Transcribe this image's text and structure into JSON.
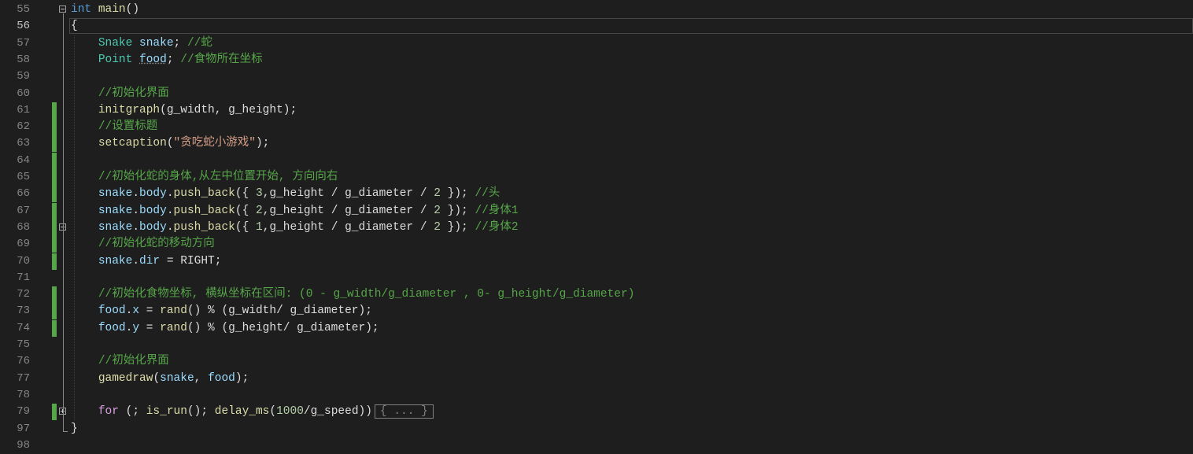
{
  "editor": {
    "lines": [
      {
        "no": "55",
        "fold": "minus",
        "mark": false,
        "tokens": [
          {
            "t": "int",
            "c": "kw"
          },
          {
            "t": " ",
            "c": "pl"
          },
          {
            "t": "main",
            "c": "fn"
          },
          {
            "t": "()",
            "c": "pl"
          }
        ]
      },
      {
        "no": "56",
        "current": true,
        "fold": "",
        "mark": false,
        "tokens": [
          {
            "t": "{",
            "c": "pl"
          }
        ]
      },
      {
        "no": "57",
        "fold": "",
        "mark": false,
        "tokens": [
          {
            "t": "    ",
            "c": "pl"
          },
          {
            "t": "Snake",
            "c": "type"
          },
          {
            "t": " ",
            "c": "pl"
          },
          {
            "t": "snake",
            "c": "var"
          },
          {
            "t": "; ",
            "c": "pl"
          },
          {
            "t": "//蛇",
            "c": "com"
          }
        ]
      },
      {
        "no": "58",
        "fold": "",
        "mark": false,
        "tokens": [
          {
            "t": "    ",
            "c": "pl"
          },
          {
            "t": "Point",
            "c": "type"
          },
          {
            "t": " ",
            "c": "pl"
          },
          {
            "t": "food",
            "c": "var"
          },
          {
            "t": "; ",
            "c": "pl"
          },
          {
            "t": "//食物所在坐标",
            "c": "com"
          }
        ]
      },
      {
        "no": "59",
        "fold": "",
        "mark": false,
        "tokens": []
      },
      {
        "no": "60",
        "fold": "",
        "mark": false,
        "tokens": [
          {
            "t": "    ",
            "c": "pl"
          },
          {
            "t": "//初始化界面",
            "c": "com"
          }
        ]
      },
      {
        "no": "61",
        "fold": "",
        "mark": true,
        "tokens": [
          {
            "t": "    ",
            "c": "pl"
          },
          {
            "t": "initgraph",
            "c": "fn"
          },
          {
            "t": "(g_width, g_height);",
            "c": "pl"
          }
        ]
      },
      {
        "no": "62",
        "fold": "",
        "mark": true,
        "tokens": [
          {
            "t": "    ",
            "c": "pl"
          },
          {
            "t": "//设置标题",
            "c": "com"
          }
        ]
      },
      {
        "no": "63",
        "fold": "",
        "mark": true,
        "tokens": [
          {
            "t": "    ",
            "c": "pl"
          },
          {
            "t": "setcaption",
            "c": "fn"
          },
          {
            "t": "(",
            "c": "pl"
          },
          {
            "t": "\"贪吃蛇小游戏\"",
            "c": "str"
          },
          {
            "t": ");",
            "c": "pl"
          }
        ]
      },
      {
        "no": "64",
        "fold": "",
        "mark": true,
        "tokens": []
      },
      {
        "no": "65",
        "fold": "",
        "mark": true,
        "tokens": [
          {
            "t": "    ",
            "c": "pl"
          },
          {
            "t": "//初始化蛇的身体,从左中位置开始, 方向向右",
            "c": "com"
          }
        ]
      },
      {
        "no": "66",
        "fold": "",
        "mark": true,
        "tokens": [
          {
            "t": "    ",
            "c": "pl"
          },
          {
            "t": "snake",
            "c": "var"
          },
          {
            "t": ".",
            "c": "pl"
          },
          {
            "t": "body",
            "c": "var"
          },
          {
            "t": ".",
            "c": "pl"
          },
          {
            "t": "push_back",
            "c": "fn"
          },
          {
            "t": "({ ",
            "c": "pl"
          },
          {
            "t": "3",
            "c": "num"
          },
          {
            "t": ",g_height / g_diameter / ",
            "c": "pl"
          },
          {
            "t": "2",
            "c": "num"
          },
          {
            "t": " }); ",
            "c": "pl"
          },
          {
            "t": "//头",
            "c": "com"
          }
        ]
      },
      {
        "no": "67",
        "fold": "",
        "mark": true,
        "tokens": [
          {
            "t": "    ",
            "c": "pl"
          },
          {
            "t": "snake",
            "c": "var"
          },
          {
            "t": ".",
            "c": "pl"
          },
          {
            "t": "body",
            "c": "var"
          },
          {
            "t": ".",
            "c": "pl"
          },
          {
            "t": "push_back",
            "c": "fn"
          },
          {
            "t": "({ ",
            "c": "pl"
          },
          {
            "t": "2",
            "c": "num"
          },
          {
            "t": ",g_height / g_diameter / ",
            "c": "pl"
          },
          {
            "t": "2",
            "c": "num"
          },
          {
            "t": " }); ",
            "c": "pl"
          },
          {
            "t": "//身体1",
            "c": "com"
          }
        ]
      },
      {
        "no": "68",
        "fold": "minus",
        "mark": true,
        "tokens": [
          {
            "t": "    ",
            "c": "pl"
          },
          {
            "t": "snake",
            "c": "var"
          },
          {
            "t": ".",
            "c": "pl"
          },
          {
            "t": "body",
            "c": "var"
          },
          {
            "t": ".",
            "c": "pl"
          },
          {
            "t": "push_back",
            "c": "fn"
          },
          {
            "t": "({ ",
            "c": "pl"
          },
          {
            "t": "1",
            "c": "num"
          },
          {
            "t": ",g_height / g_diameter / ",
            "c": "pl"
          },
          {
            "t": "2",
            "c": "num"
          },
          {
            "t": " }); ",
            "c": "pl"
          },
          {
            "t": "//身体2",
            "c": "com"
          }
        ]
      },
      {
        "no": "69",
        "fold": "",
        "mark": true,
        "tokens": [
          {
            "t": "    ",
            "c": "pl"
          },
          {
            "t": "//初始化蛇的移动方向",
            "c": "com"
          }
        ]
      },
      {
        "no": "70",
        "fold": "",
        "mark": true,
        "tokens": [
          {
            "t": "    ",
            "c": "pl"
          },
          {
            "t": "snake",
            "c": "var"
          },
          {
            "t": ".",
            "c": "pl"
          },
          {
            "t": "dir",
            "c": "var"
          },
          {
            "t": " = ",
            "c": "pl"
          },
          {
            "t": "RIGHT",
            "c": "pl"
          },
          {
            "t": ";",
            "c": "pl"
          }
        ]
      },
      {
        "no": "71",
        "fold": "",
        "mark": false,
        "tokens": []
      },
      {
        "no": "72",
        "fold": "",
        "mark": true,
        "tokens": [
          {
            "t": "    ",
            "c": "pl"
          },
          {
            "t": "//初始化食物坐标, 横纵坐标在区间: (0 - g_width/g_diameter , 0- g_height/g_diameter)",
            "c": "com"
          }
        ]
      },
      {
        "no": "73",
        "fold": "",
        "mark": true,
        "tokens": [
          {
            "t": "    ",
            "c": "pl"
          },
          {
            "t": "food",
            "c": "var"
          },
          {
            "t": ".",
            "c": "pl"
          },
          {
            "t": "x",
            "c": "var"
          },
          {
            "t": " = ",
            "c": "pl"
          },
          {
            "t": "rand",
            "c": "fn"
          },
          {
            "t": "() % (g_width/ g_diameter);",
            "c": "pl"
          }
        ]
      },
      {
        "no": "74",
        "fold": "",
        "mark": true,
        "tokens": [
          {
            "t": "    ",
            "c": "pl"
          },
          {
            "t": "food",
            "c": "var"
          },
          {
            "t": ".",
            "c": "pl"
          },
          {
            "t": "y",
            "c": "var"
          },
          {
            "t": " = ",
            "c": "pl"
          },
          {
            "t": "rand",
            "c": "fn"
          },
          {
            "t": "() % (g_height/ g_diameter);",
            "c": "pl"
          }
        ]
      },
      {
        "no": "75",
        "fold": "",
        "mark": false,
        "tokens": []
      },
      {
        "no": "76",
        "fold": "",
        "mark": false,
        "tokens": [
          {
            "t": "    ",
            "c": "pl"
          },
          {
            "t": "//初始化界面",
            "c": "com"
          }
        ]
      },
      {
        "no": "77",
        "fold": "",
        "mark": false,
        "tokens": [
          {
            "t": "    ",
            "c": "pl"
          },
          {
            "t": "gamedraw",
            "c": "fn"
          },
          {
            "t": "(",
            "c": "pl"
          },
          {
            "t": "snake",
            "c": "var"
          },
          {
            "t": ", ",
            "c": "pl"
          },
          {
            "t": "food",
            "c": "var"
          },
          {
            "t": ");",
            "c": "pl"
          }
        ]
      },
      {
        "no": "78",
        "fold": "",
        "mark": false,
        "tokens": []
      },
      {
        "no": "79",
        "fold": "plus",
        "mark": true,
        "tokens": [
          {
            "t": "    ",
            "c": "pl"
          },
          {
            "t": "for",
            "c": "ctl"
          },
          {
            "t": " (; ",
            "c": "pl"
          },
          {
            "t": "is_run",
            "c": "fn"
          },
          {
            "t": "(); ",
            "c": "pl"
          },
          {
            "t": "delay_ms",
            "c": "fn"
          },
          {
            "t": "(",
            "c": "pl"
          },
          {
            "t": "1000",
            "c": "num"
          },
          {
            "t": "/g_speed))",
            "c": "pl"
          },
          {
            "t": "{ ... }",
            "c": "box"
          }
        ]
      },
      {
        "no": "97",
        "fold": "",
        "mark": false,
        "tokens": [
          {
            "t": "}",
            "c": "pl"
          }
        ]
      },
      {
        "no": "98",
        "fold": "",
        "mark": false,
        "tokens": []
      }
    ]
  }
}
